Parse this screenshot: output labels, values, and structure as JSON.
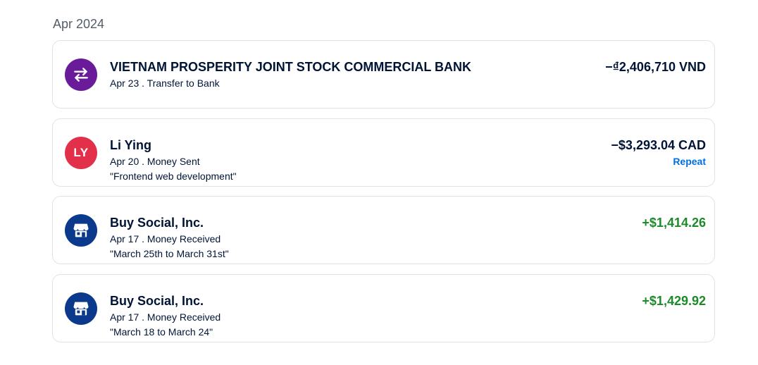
{
  "month_label": "Apr 2024",
  "colors": {
    "transfer_avatar": "#6a1b9a",
    "person_avatar": "#e3304a",
    "merchant_avatar": "#0b3a8c",
    "positive_amount": "#1d8a2a",
    "link": "#0070e0"
  },
  "transactions": [
    {
      "name": "VIETNAM PROSPERITY JOINT STOCK COMMERCIAL BANK",
      "subtitle": "Apr 23 . Transfer to Bank",
      "amount": "−₫2,406,710 VND",
      "icon": "transfer-arrows-icon"
    },
    {
      "name": "Li Ying",
      "subtitle": "Apr 20 . Money Sent",
      "note": "\"Frontend web development\"",
      "amount": "−$3,293.04 CAD",
      "action": "Repeat",
      "avatar_initials": "LY"
    },
    {
      "name": "Buy Social, Inc.",
      "subtitle": "Apr 17 . Money Received",
      "note": "\"March 25th to March 31st\"",
      "amount": "+$1,414.26",
      "icon": "storefront-icon"
    },
    {
      "name": "Buy Social, Inc.",
      "subtitle": "Apr 17 . Money Received",
      "note": "\"March 18 to March 24\"",
      "amount": "+$1,429.92",
      "icon": "storefront-icon"
    }
  ]
}
